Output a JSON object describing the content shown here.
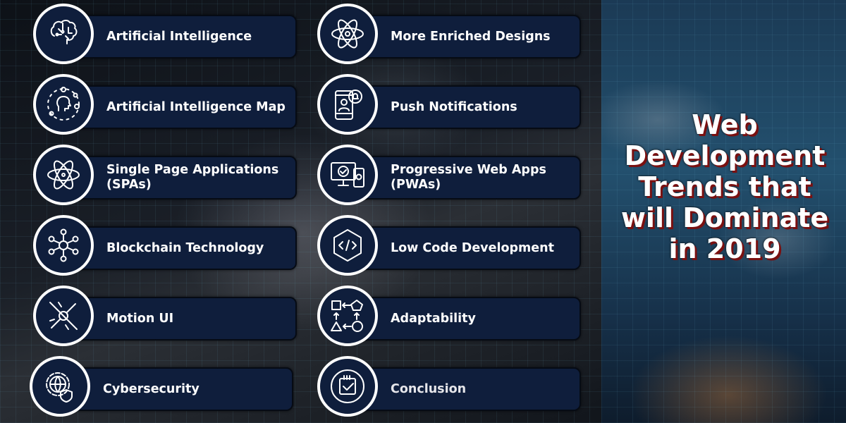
{
  "title": {
    "lines": [
      "Web",
      "Development",
      "Trends that",
      "will Dominate",
      "in 2019"
    ]
  },
  "left_column": [
    {
      "label": "Artificial Intelligence",
      "icon": "brain-circuit-icon"
    },
    {
      "label": "Artificial Intelligence Map",
      "icon": "ai-head-map-icon"
    },
    {
      "label": "Single Page Applications (SPAs)",
      "icon": "atom-orbit-icon"
    },
    {
      "label": "Blockchain Technology",
      "icon": "blockchain-network-icon"
    },
    {
      "label": "Motion UI",
      "icon": "motion-target-icon"
    },
    {
      "label": "Cybersecurity",
      "icon": "globe-shield-gear-icon"
    }
  ],
  "right_column": [
    {
      "label": "More Enriched Designs",
      "icon": "atom-icon"
    },
    {
      "label": "Push Notifications",
      "icon": "phone-bell-icon"
    },
    {
      "label": "Progressive Web Apps (PWAs)",
      "icon": "devices-check-icon"
    },
    {
      "label": "Low Code Development",
      "icon": "code-hexagon-icon"
    },
    {
      "label": "Adaptability",
      "icon": "shapes-arrows-icon"
    },
    {
      "label": "Conclusion",
      "icon": "calendar-check-icon"
    }
  ],
  "colors": {
    "card": "#0f1e3c",
    "title_shadow": "#7a1010",
    "text": "#ffffff"
  }
}
